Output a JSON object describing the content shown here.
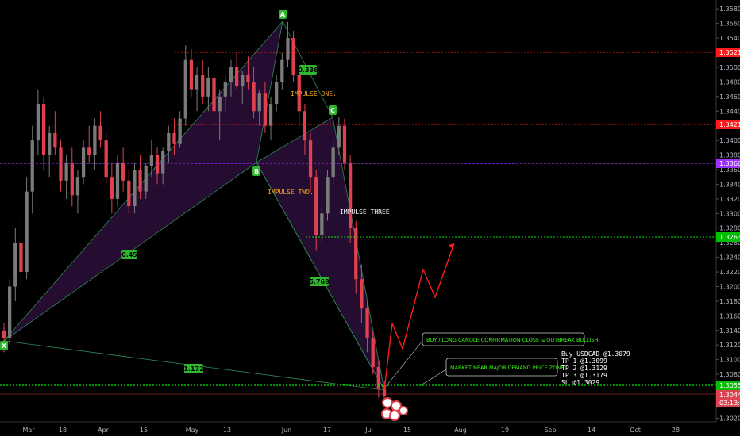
{
  "chart_data": {
    "type": "candlestick",
    "symbol": "USDCAD",
    "colors": {
      "background": "#000000",
      "bull_candle": "#7a7a7a",
      "bear_candle": "#e0414e",
      "pattern_fill": "#2a0f3a",
      "pattern_line": "#2e8b57",
      "pattern_label_bg": "#2eb82e",
      "resistance_red": "#ff1a1a",
      "mid_purple": "#9b30ff",
      "demand_green": "#00e600",
      "projection": "#ff1a1a",
      "callout_text": "#39ff14"
    },
    "x_axis": {
      "ticks": [
        "Mar",
        "18",
        "Apr",
        "15",
        "May",
        "13",
        "Jun",
        "17",
        "Jul",
        "15",
        "Aug",
        "19",
        "Sep",
        "14",
        "Oct",
        "28"
      ]
    },
    "y_axis": {
      "range": [
        1.3015,
        1.359
      ],
      "ticks": [
        "1.35800",
        "1.35600",
        "1.35400",
        "1.35200",
        "1.35000",
        "1.34800",
        "1.34600",
        "1.34400",
        "1.34200",
        "1.34000",
        "1.33800",
        "1.33600",
        "1.33400",
        "1.33200",
        "1.33000",
        "1.32800",
        "1.32600",
        "1.32400",
        "1.32200",
        "1.32000",
        "1.31800",
        "1.31600",
        "1.31400",
        "1.31200",
        "1.31000",
        "1.30800",
        "1.30600",
        "1.30400",
        "1.30200"
      ]
    },
    "horizontal_levels": [
      {
        "name": "resistance-1",
        "price": 1.35215,
        "label": "1.35215",
        "color": "#ff1a1a"
      },
      {
        "name": "resistance-2",
        "price": 1.34213,
        "label": "1.34213",
        "color": "#ff1a1a"
      },
      {
        "name": "mid-level",
        "price": 1.33669,
        "label": "1.33669",
        "color": "#9b30ff"
      },
      {
        "name": "target-level",
        "price": 1.32635,
        "label": "1.32635",
        "color": "#00e600"
      },
      {
        "name": "demand-level",
        "price": 1.30559,
        "label": "1.30559",
        "color": "#00e600"
      },
      {
        "name": "current-price",
        "price": 1.30449,
        "label": "1.30449",
        "color": "#e0414e"
      }
    ],
    "countdown_label": "03:13:50",
    "pattern_points": [
      {
        "label": "X",
        "price": 1.3123
      },
      {
        "label": "A",
        "price": 1.3562
      },
      {
        "label": "B",
        "price": 1.337
      },
      {
        "label": "C",
        "price": 1.3432
      },
      {
        "label": "D",
        "price": 1.3048
      }
    ],
    "ratio_labels": [
      "0.336",
      "0.45",
      "5.768",
      "1.172"
    ],
    "annotations": [
      "IMPULSE ONE.",
      "IMPULSE TWO.",
      "IMPULSE THREE"
    ],
    "projection_path": [
      1.3048,
      1.3145,
      1.311,
      1.3222,
      1.318,
      1.3262
    ],
    "callouts": {
      "buy": "BUY / LONG CANDLE CONFIRMATION CLOSE & OUTBREAK BULLISH.",
      "market": "MARKET NEAR MAJOR DEMAND PRICE ZONE."
    },
    "order_lines": [
      "Buy USDCAD @1.3079",
      "TP 1 @1.3099",
      "TP 2 @1.3129",
      "TP 3 @1.3179",
      "SL @1.3029"
    ],
    "candles": [
      [
        1.314,
        1.315,
        1.311,
        1.313
      ],
      [
        1.313,
        1.321,
        1.312,
        1.32
      ],
      [
        1.32,
        1.328,
        1.318,
        1.326
      ],
      [
        1.326,
        1.33,
        1.32,
        1.322
      ],
      [
        1.322,
        1.335,
        1.321,
        1.333
      ],
      [
        1.333,
        1.342,
        1.33,
        1.34
      ],
      [
        1.34,
        1.347,
        1.338,
        1.345
      ],
      [
        1.345,
        1.346,
        1.336,
        1.338
      ],
      [
        1.338,
        1.342,
        1.335,
        1.341
      ],
      [
        1.341,
        1.344,
        1.338,
        1.339
      ],
      [
        1.339,
        1.34,
        1.333,
        1.3345
      ],
      [
        1.3345,
        1.338,
        1.332,
        1.337
      ],
      [
        1.337,
        1.339,
        1.331,
        1.3325
      ],
      [
        1.3325,
        1.336,
        1.33,
        1.335
      ],
      [
        1.335,
        1.34,
        1.334,
        1.339
      ],
      [
        1.339,
        1.342,
        1.337,
        1.338
      ],
      [
        1.338,
        1.343,
        1.336,
        1.342
      ],
      [
        1.342,
        1.344,
        1.339,
        1.34
      ],
      [
        1.34,
        1.341,
        1.334,
        1.335
      ],
      [
        1.335,
        1.337,
        1.33,
        1.332
      ],
      [
        1.332,
        1.338,
        1.331,
        1.337
      ],
      [
        1.337,
        1.339,
        1.333,
        1.3345
      ],
      [
        1.3345,
        1.336,
        1.33,
        1.331
      ],
      [
        1.331,
        1.337,
        1.33,
        1.336
      ],
      [
        1.336,
        1.338,
        1.332,
        1.333
      ],
      [
        1.333,
        1.337,
        1.332,
        1.3365
      ],
      [
        1.3365,
        1.34,
        1.335,
        1.338
      ],
      [
        1.338,
        1.339,
        1.334,
        1.3355
      ],
      [
        1.3355,
        1.339,
        1.334,
        1.3385
      ],
      [
        1.3385,
        1.342,
        1.337,
        1.341
      ],
      [
        1.341,
        1.343,
        1.338,
        1.3395
      ],
      [
        1.3395,
        1.344,
        1.339,
        1.343
      ],
      [
        1.343,
        1.353,
        1.342,
        1.351
      ],
      [
        1.351,
        1.3525,
        1.346,
        1.347
      ],
      [
        1.347,
        1.35,
        1.344,
        1.349
      ],
      [
        1.349,
        1.351,
        1.345,
        1.346
      ],
      [
        1.346,
        1.35,
        1.344,
        1.3485
      ],
      [
        1.3485,
        1.35,
        1.343,
        1.344
      ],
      [
        1.344,
        1.347,
        1.34,
        1.346
      ],
      [
        1.346,
        1.349,
        1.344,
        1.348
      ],
      [
        1.348,
        1.351,
        1.346,
        1.35
      ],
      [
        1.35,
        1.352,
        1.347,
        1.3475
      ],
      [
        1.3475,
        1.3495,
        1.345,
        1.349
      ],
      [
        1.349,
        1.3515,
        1.347,
        1.348
      ],
      [
        1.348,
        1.35,
        1.343,
        1.344
      ],
      [
        1.344,
        1.347,
        1.342,
        1.3465
      ],
      [
        1.3465,
        1.348,
        1.341,
        1.342
      ],
      [
        1.342,
        1.346,
        1.34,
        1.345
      ],
      [
        1.345,
        1.349,
        1.344,
        1.348
      ],
      [
        1.348,
        1.352,
        1.347,
        1.351
      ],
      [
        1.351,
        1.3562,
        1.35,
        1.354
      ],
      [
        1.354,
        1.355,
        1.348,
        1.349
      ],
      [
        1.349,
        1.35,
        1.342,
        1.344
      ],
      [
        1.344,
        1.345,
        1.338,
        1.34
      ],
      [
        1.34,
        1.341,
        1.333,
        1.335
      ],
      [
        1.335,
        1.336,
        1.325,
        1.327
      ],
      [
        1.327,
        1.331,
        1.326,
        1.33
      ],
      [
        1.33,
        1.336,
        1.329,
        1.335
      ],
      [
        1.335,
        1.34,
        1.334,
        1.339
      ],
      [
        1.339,
        1.3432,
        1.338,
        1.342
      ],
      [
        1.342,
        1.343,
        1.336,
        1.337
      ],
      [
        1.337,
        1.338,
        1.326,
        1.328
      ],
      [
        1.328,
        1.329,
        1.319,
        1.321
      ],
      [
        1.321,
        1.323,
        1.315,
        1.317
      ],
      [
        1.317,
        1.318,
        1.311,
        1.313
      ],
      [
        1.313,
        1.314,
        1.308,
        1.309
      ],
      [
        1.309,
        1.31,
        1.3048,
        1.306
      ],
      [
        1.306,
        1.307,
        1.3045,
        1.305
      ]
    ]
  },
  "price_tags": {
    "r1": "1.35215",
    "r2": "1.34213",
    "mid": "1.33669",
    "target": "1.32635",
    "demand": "1.30559",
    "current": "1.30449",
    "countdown": "03:13:50"
  },
  "points": {
    "x": "X",
    "a": "A",
    "b": "B",
    "c": "C"
  },
  "ratios": {
    "xa": "0.336",
    "xb": "0.45",
    "bc": "5.768",
    "xd": "1.172"
  },
  "labels": {
    "impulse_one": "IMPULSE ONE.",
    "impulse_two": "IMPULSE TWO.",
    "impulse_three": "IMPULSE THREE"
  },
  "callouts": {
    "buy": "BUY / LONG CANDLE CONFIRMATION CLOSE & OUTBREAK BULLISH.",
    "market": "MARKET NEAR MAJOR DEMAND PRICE ZONE."
  },
  "order_block": [
    "Buy USDCAD @1.3079",
    "TP 1 @1.3099",
    "TP 2 @1.3129",
    "TP 3 @1.3179",
    "SL @1.3029"
  ]
}
